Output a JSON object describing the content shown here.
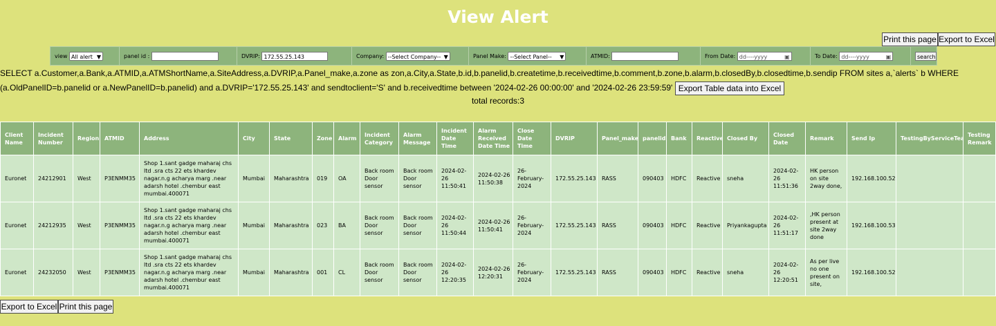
{
  "page": {
    "title": "View Alert",
    "print_top": "Print this page",
    "export_top": "Export to Excel",
    "export_bottom": "Export to Excel",
    "print_bottom": "Print this page"
  },
  "filters": {
    "view_label": "view",
    "view_value": "All alert",
    "panel_id_label": "panel id :",
    "panel_id_value": "",
    "dvrip_label": "DVRIP:",
    "dvrip_value": "172.55.25.143",
    "company_label": "Company:",
    "company_value": "--Select Company--",
    "panel_make_label": "Panel Make:",
    "panel_make_value": "--Select Panel--",
    "atmid_label": "ATMID:",
    "atmid_value": "",
    "from_date_label": "From Date:",
    "from_date_placeholder": "dd----yyyy",
    "to_date_label": "To Date:",
    "to_date_placeholder": "dd----yyyy",
    "search_label": "search"
  },
  "query": {
    "sql": "SELECT a.Customer,a.Bank,a.ATMID,a.ATMShortName,a.SiteAddress,a.DVRIP,a.Panel_make,a.zone as zon,a.City,a.State,b.id,b.panelid,b.createtime,b.receivedtime,b.comment,b.zone,b.alarm,b.closedBy,b.closedtime,b.sendip FROM sites a,`alerts` b WHERE (a.OldPanelID=b.panelid or a.NewPanelID=b.panelid) and a.DVRIP='172.55.25.143' and sendtoclient='S' and b.receivedtime between '2024-02-26 00:00:00' and '2024-02-26 23:59:59'",
    "export_table_label": "Export Table data into Excel",
    "total_records": "total records:3"
  },
  "table": {
    "headers": [
      "Client Name",
      "Incident Number",
      "Region",
      "ATMID",
      "Address",
      "City",
      "State",
      "Zone",
      "Alarm",
      "Incident Category",
      "Alarm Message",
      "Incident Date Time",
      "Alarm Received Date Time",
      "Close Date Time",
      "DVRIP",
      "Panel_make",
      "panelid",
      "Bank",
      "Reactive",
      "Closed By",
      "Closed Date",
      "Remark",
      "Send Ip",
      "TestingByServiceTeam",
      "Testing Remark"
    ],
    "rows": [
      [
        "Euronet",
        "24212901",
        "West",
        "P3ENMM35",
        "Shop 1.sant gadge maharaj  chs ltd .sra cts 22 ets khardev nagar.n.g acharya marg .near adarsh hotel .chembur east mumbai.400071",
        "Mumbai",
        "Maharashtra",
        "019",
        "OA",
        "Back room Door sensor",
        "Back room Door sensor",
        "2024-02-26 11:50:41",
        "2024-02-26 11:50:38",
        "26-February-2024",
        "172.55.25.143",
        "RASS",
        "090403",
        "HDFC",
        "Reactive",
        "sneha",
        "2024-02-26 11:51:36",
        "HK person on site 2way done,",
        "192.168.100.52",
        "",
        ""
      ],
      [
        "Euronet",
        "24212935",
        "West",
        "P3ENMM35",
        "Shop 1.sant gadge maharaj  chs ltd .sra cts 22 ets khardev nagar.n.g acharya marg .near adarsh hotel .chembur east mumbai.400071",
        "Mumbai",
        "Maharashtra",
        "023",
        "BA",
        "Back room Door sensor",
        "Back room Door sensor",
        "2024-02-26 11:50:44",
        "2024-02-26 11:50:41",
        "26-February-2024",
        "172.55.25.143",
        "RASS",
        "090403",
        "HDFC",
        "Reactive",
        "Priyankagupta",
        "2024-02-26 11:51:17",
        ",HK person present at site 2way done",
        "192.168.100.53",
        "",
        ""
      ],
      [
        "Euronet",
        "24232050",
        "West",
        "P3ENMM35",
        "Shop 1.sant gadge maharaj  chs ltd .sra cts 22 ets khardev nagar.n.g acharya marg .near adarsh hotel .chembur east mumbai.400071",
        "Mumbai",
        "Maharashtra",
        "001",
        "CL",
        "Back room Door sensor",
        "Back room Door sensor",
        "2024-02-26 12:20:35",
        "2024-02-26 12:20:31",
        "26-February-2024",
        "172.55.25.143",
        "RASS",
        "090403",
        "HDFC",
        "Reactive",
        "sneha",
        "2024-02-26 12:20:51",
        "As per live no one present on site,",
        "192.168.100.52",
        "",
        ""
      ]
    ]
  }
}
